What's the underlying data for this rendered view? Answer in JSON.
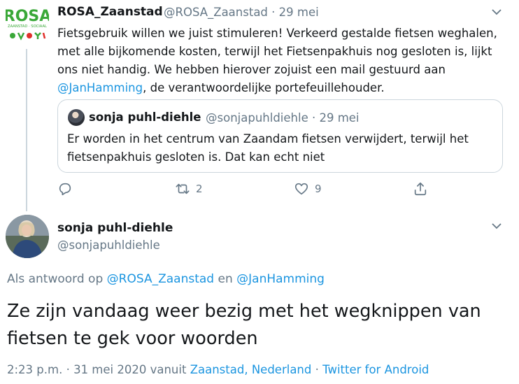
{
  "parent_tweet": {
    "logo_text": "ROSA",
    "logo_tagline": "ZAANSTAD · SOCIAAL",
    "display_name": "ROSA_Zaanstad",
    "meta": "@ROSA_Zaanstad · 29 mei",
    "text_before": "Fietsgebruik willen we juist stimuleren! Verkeerd gestalde fietsen weghalen, met alle bijkomende kosten, terwijl het Fietsenpakhuis nog gesloten is, lijkt ons niet handig. We hebben hierover zojuist een mail gestuurd aan ",
    "mention": "@JanHamming",
    "text_after": ", de verantwoordelijke portefeuillehouder.",
    "quote": {
      "display_name": "sonja puhl-diehle",
      "meta": "@sonjapuhldiehle · 29 mei",
      "text": "Er worden in het centrum van Zaandam fietsen verwijdert, terwijl het fietsenpakhuis gesloten is. Dat kan echt niet"
    },
    "actions": {
      "retweets": "2",
      "likes": "9"
    }
  },
  "main_tweet": {
    "display_name": "sonja puhl-diehle",
    "handle": "@sonjapuhldiehle",
    "reply_prefix": "Als antwoord op ",
    "reply_mention_1": "@ROSA_Zaanstad",
    "reply_and": " en ",
    "reply_mention_2": "@JanHamming",
    "text": "Ze zijn vandaag weer bezig met het wegknippen van fietsen te gek voor woorden",
    "time": "2:23 p.m. · 31 mei 2020 vanuit ",
    "location": "Zaanstad, Nederland",
    "separator": " · ",
    "client": "Twitter for Android"
  },
  "colors": {
    "accent": "#1b95e0",
    "secondary_text": "#657786",
    "logo_green": "#3aa838",
    "logo_red": "#e0312b"
  }
}
